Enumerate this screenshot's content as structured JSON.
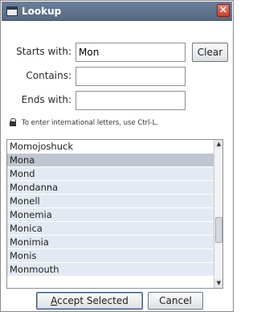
{
  "window": {
    "title": "Lookup",
    "close_label": "×"
  },
  "form": {
    "starts_with_label": "Starts with:",
    "starts_with_value": "Mon",
    "contains_label": "Contains:",
    "contains_value": "",
    "ends_with_label": "Ends with:",
    "ends_with_value": "",
    "clear_label": "Clear",
    "hint": "To enter international letters, use Ctrl-L."
  },
  "list": {
    "items": [
      "Momojoshuck",
      "Mona",
      "Mond",
      "Mondanna",
      "Monell",
      "Monemia",
      "Monica",
      "Monimia",
      "Monis",
      "Monmouth"
    ],
    "highlighted_index": 1
  },
  "buttons": {
    "accept_first_letter": "A",
    "accept_rest": "ccept Selected",
    "cancel_label": "Cancel"
  }
}
